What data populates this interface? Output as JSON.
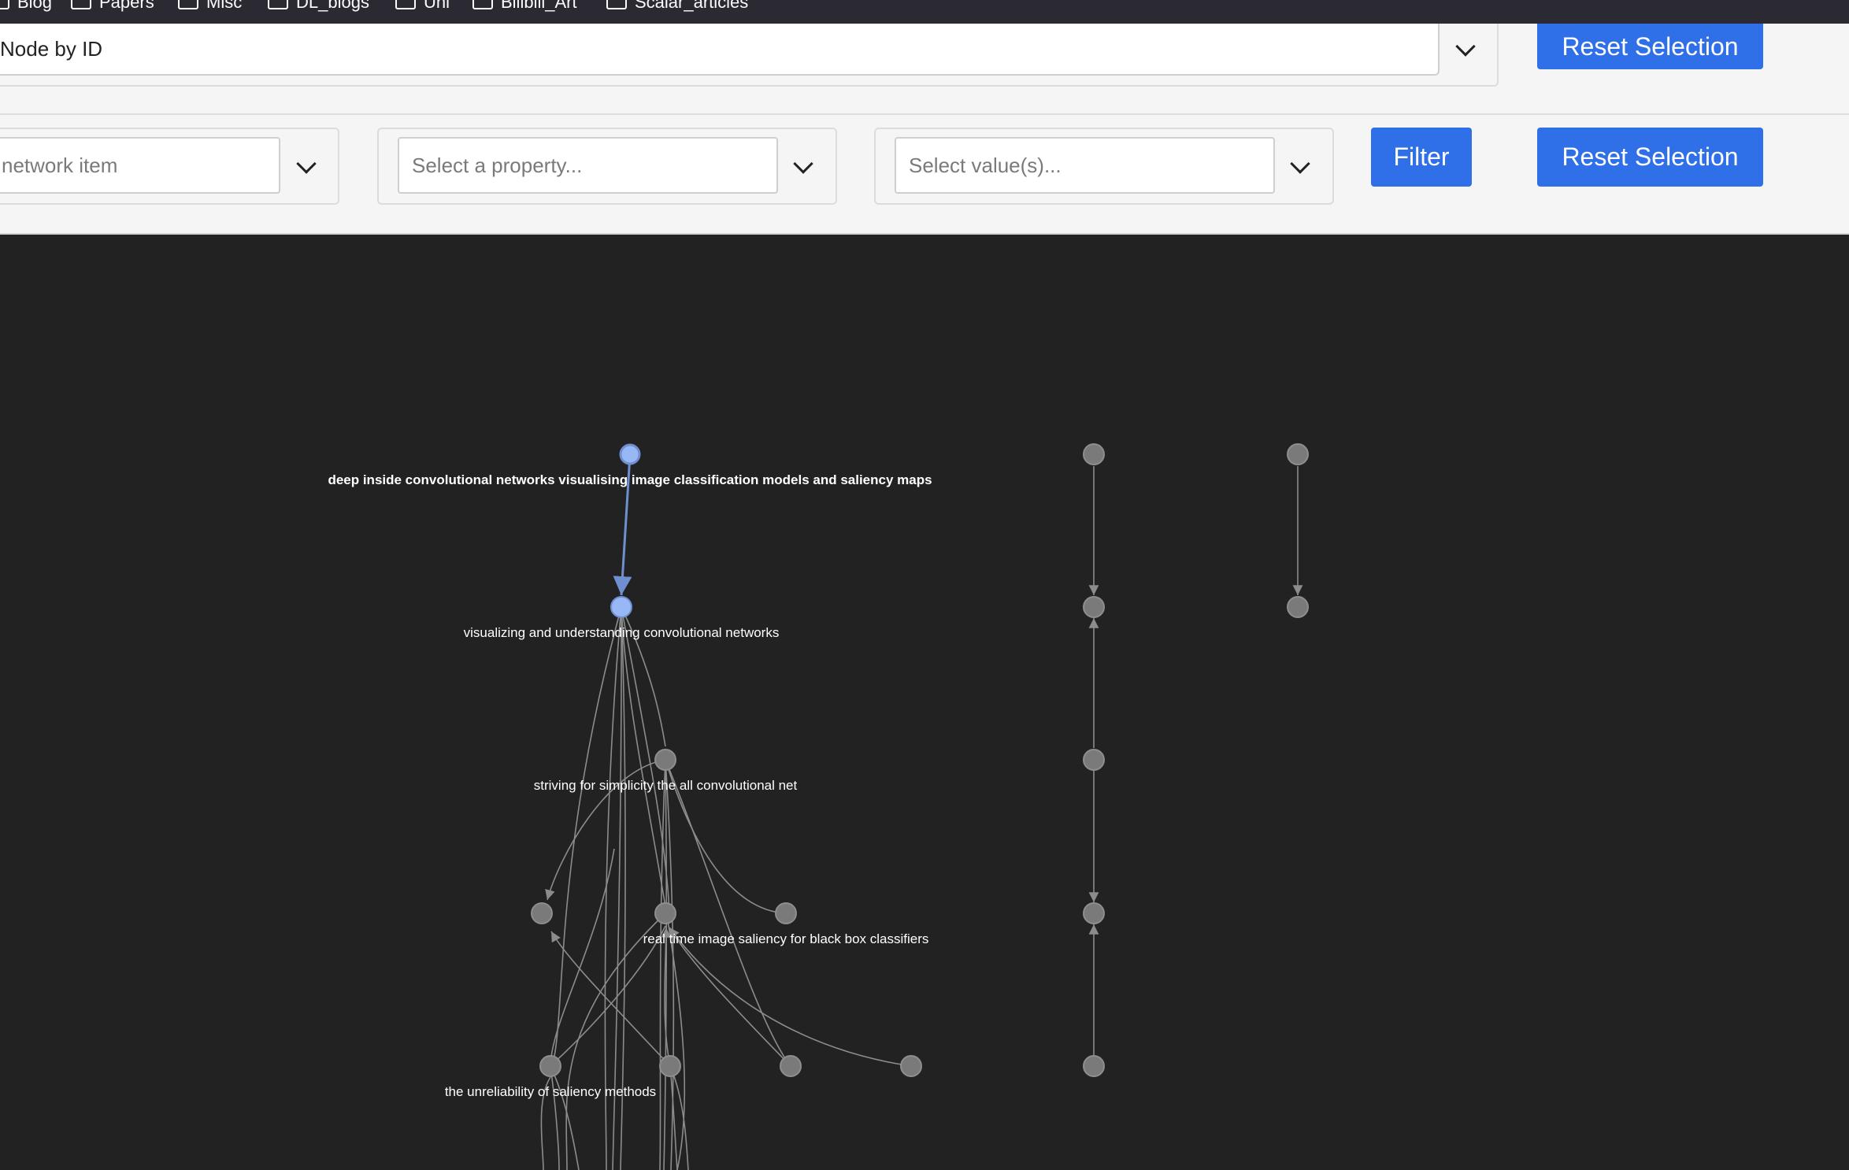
{
  "bookmarks": [
    {
      "label": "Blog"
    },
    {
      "label": "Papers"
    },
    {
      "label": "Misc"
    },
    {
      "label": "DL_blogs"
    },
    {
      "label": "Uni"
    },
    {
      "label": "Bilibili_Art"
    },
    {
      "label": "Scalar_articles"
    }
  ],
  "row1": {
    "select_value": "Node by ID",
    "reset_label": "Reset Selection"
  },
  "row2": {
    "item_placeholder": "network item",
    "property_placeholder": "Select a property...",
    "value_placeholder": "Select value(s)...",
    "filter_label": "Filter",
    "reset_label": "Reset Selection"
  },
  "graph": {
    "colors": {
      "background": "#222222",
      "node": "#7a7a7a",
      "selected_node": "#97b8f5",
      "edge": "#8c8c8c",
      "selected_edge": "#6f8fd0"
    },
    "labels": {
      "n1": "deep inside convolutional networks visualising image classification models and saliency maps",
      "n2": "visualizing and understanding convolutional networks",
      "n3": "striving for simplicity the all convolutional net",
      "n4": "real time image saliency for black box classifiers",
      "n5": "the unreliability of saliency methods"
    }
  }
}
